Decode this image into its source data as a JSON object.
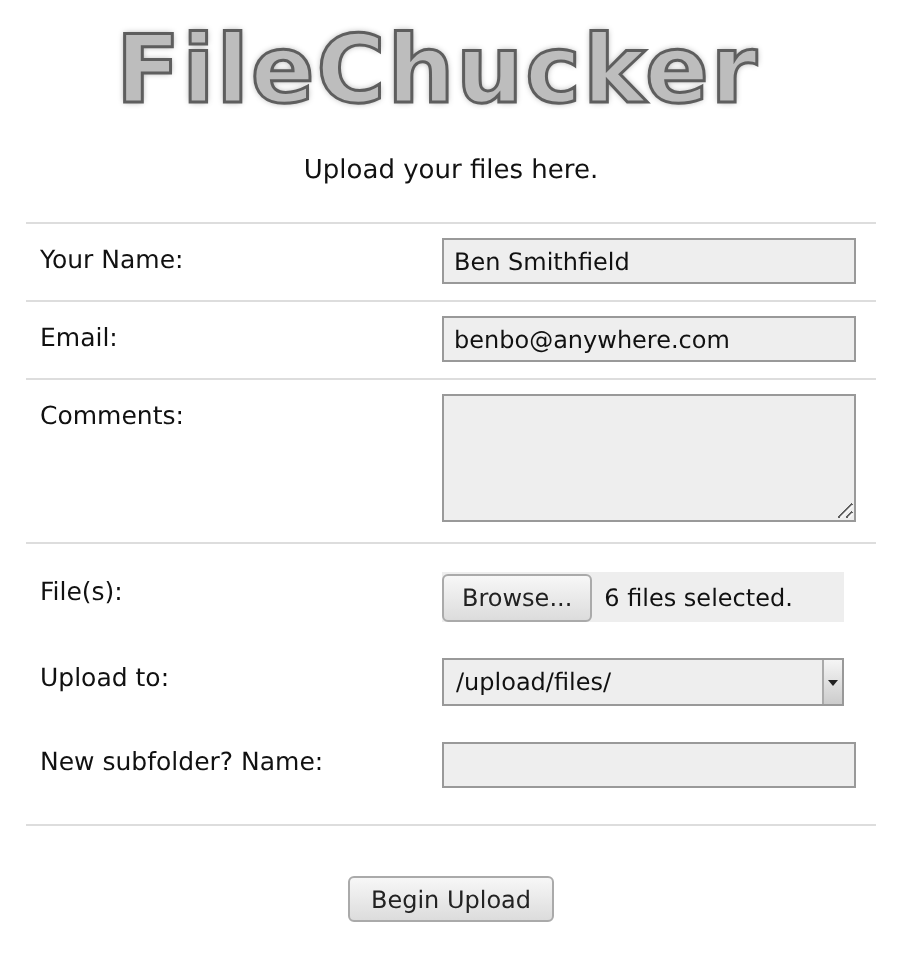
{
  "logo": "FileChucker",
  "subtitle": "Upload your files here.",
  "sections": [
    [
      {
        "kind": "text",
        "label": "Your Name:",
        "value": "Ben Smithfield"
      },
      {
        "kind": "text",
        "label": "Email:",
        "value": "benbo@anywhere.com"
      },
      {
        "kind": "textarea",
        "label": "Comments:"
      }
    ],
    [
      {
        "kind": "file",
        "label": "File(s):",
        "button": "Browse...",
        "status": "6 files selected."
      },
      {
        "kind": "select",
        "label": "Upload to:",
        "value": "/upload/files/"
      },
      {
        "kind": "text",
        "label": "New subfolder? Name:"
      }
    ]
  ],
  "submit": "Begin Upload"
}
